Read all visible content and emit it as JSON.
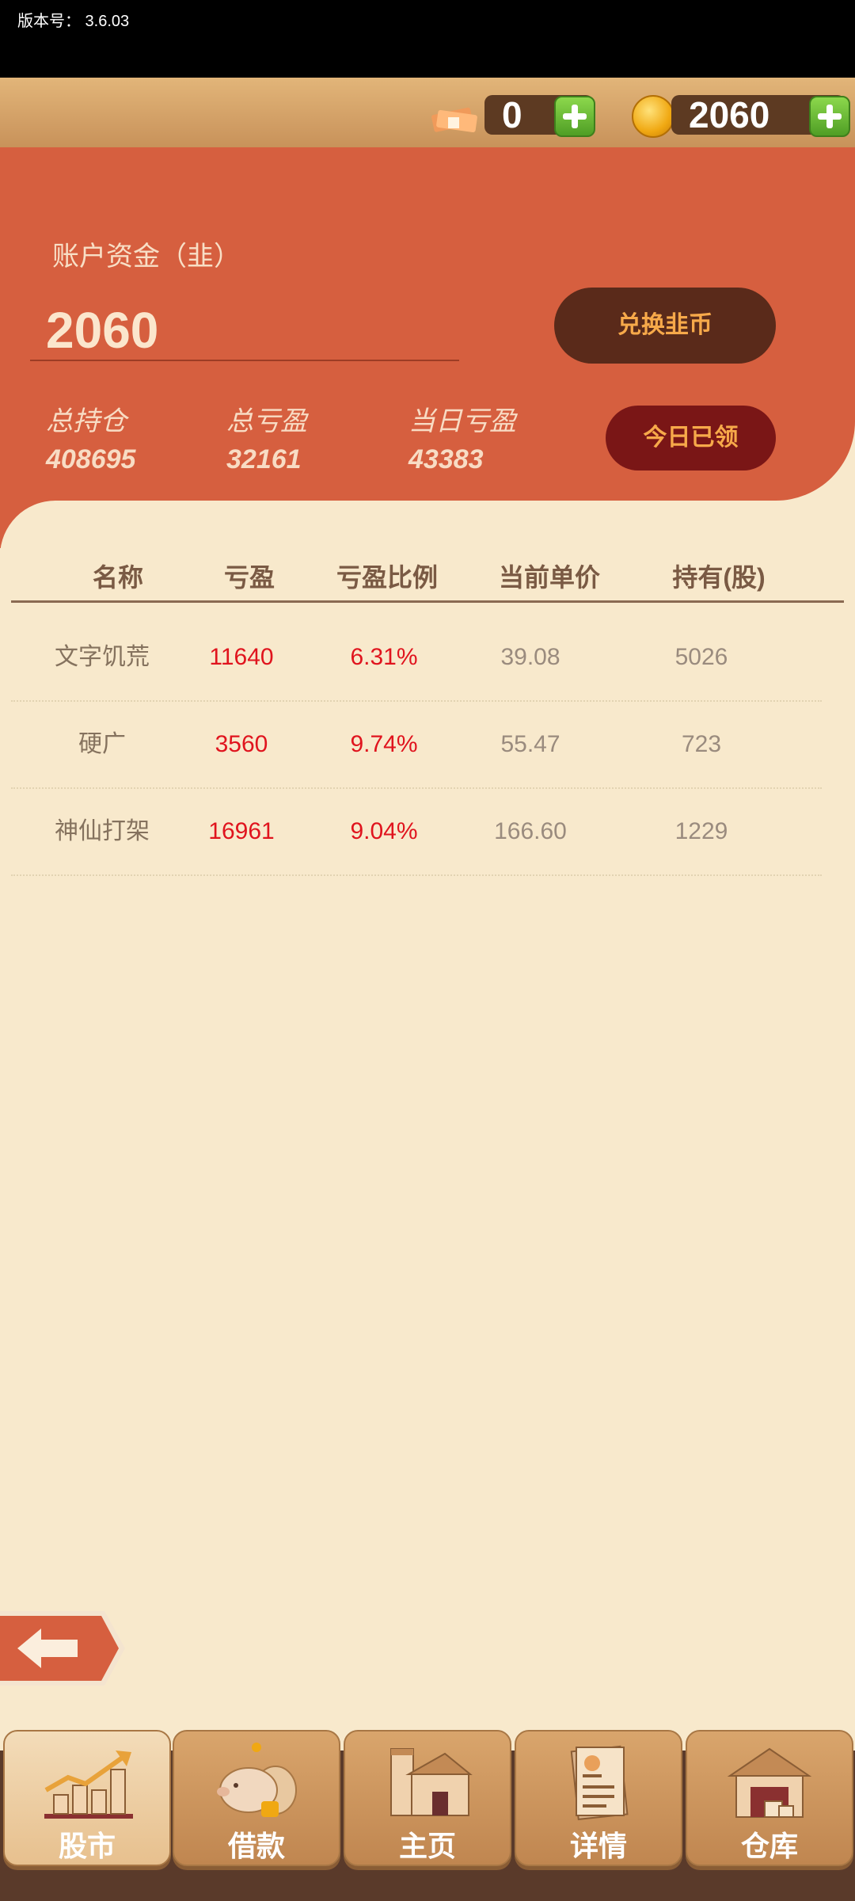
{
  "status": {
    "version": "版本号：  3.6.03"
  },
  "currency": {
    "cash_value": "0",
    "coin_value": "2060"
  },
  "account": {
    "label": "账户资金（韭）",
    "value": "2060",
    "exchange_button": "兑换韭币",
    "claimed_button": "今日已领",
    "stats": [
      {
        "label": "总持仓",
        "value": "408695"
      },
      {
        "label": "总亏盈",
        "value": "32161"
      },
      {
        "label": "当日亏盈",
        "value": "43383"
      }
    ]
  },
  "table": {
    "headers": [
      "名称",
      "亏盈",
      "亏盈比例",
      "当前单价",
      "持有(股)"
    ],
    "rows": [
      [
        "文字饥荒",
        "11640",
        "6.31%",
        "39.08",
        "5026"
      ],
      [
        "硬广",
        "3560",
        "9.74%",
        "55.47",
        "723"
      ],
      [
        "神仙打架",
        "16961",
        "9.04%",
        "166.60",
        "1229"
      ]
    ]
  },
  "nav": {
    "items": [
      "股市",
      "借款",
      "主页",
      "详情",
      "仓库"
    ]
  }
}
